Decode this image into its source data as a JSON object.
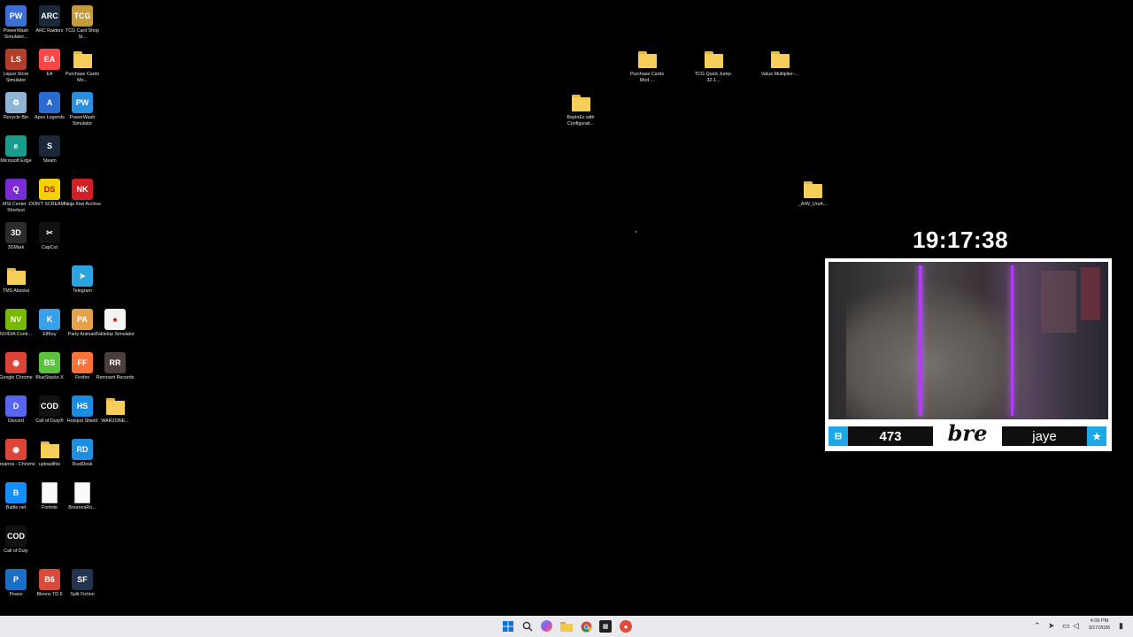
{
  "desktop": {
    "left_icons": [
      {
        "label": "PowerWash Simulator...",
        "icon": "powerwash-simulator-icon",
        "color": "#3b6fd6",
        "glyph": "PW"
      },
      {
        "label": "ARC Raiders",
        "icon": "arc-raiders-icon",
        "color": "#1b2a3a",
        "glyph": "ARC"
      },
      {
        "label": "TCG Card Shop Si...",
        "icon": "tcg-card-shop-icon",
        "color": "#c49a3a",
        "glyph": "TCG"
      },
      {
        "label": "Liquor Store Simulator",
        "icon": "liquor-store-simulator-icon",
        "color": "#b33d2a",
        "glyph": "LS"
      },
      {
        "label": "EA",
        "icon": "ea-app-icon",
        "color": "#ff4747",
        "glyph": "EA"
      },
      {
        "label": "Purchase Cards Mo...",
        "icon": "folder-icon",
        "color": "",
        "glyph": ""
      },
      {
        "label": "Recycle Bin",
        "icon": "recycle-bin-icon",
        "color": "#8fb4d8",
        "glyph": "♻"
      },
      {
        "label": "Apex Legends",
        "icon": "apex-legends-icon",
        "color": "#2a6bd0",
        "glyph": "A"
      },
      {
        "label": "PowerWash Simulator",
        "icon": "powerwash-simulator-icon",
        "color": "#2b8fe0",
        "glyph": "PW"
      },
      {
        "label": "Microsoft Edge",
        "icon": "microsoft-edge-icon",
        "color": "#1a9b8c",
        "glyph": "e"
      },
      {
        "label": "Steam",
        "icon": "steam-icon",
        "color": "#1b2838",
        "glyph": "S"
      },
      {
        "label": "MSI Center - Shortcut",
        "icon": "msi-center-icon",
        "color": "#7a2bd6",
        "glyph": "Q"
      },
      {
        "label": "DON'T SCREAM ...",
        "icon": "dont-scream-icon",
        "color": "#f2d200",
        "glyph": "DS"
      },
      {
        "label": "Ninja Kiwi Archive",
        "icon": "ninja-kiwi-archive-icon",
        "color": "#d21f26",
        "glyph": "NK"
      },
      {
        "label": "3DMark",
        "icon": "3dmark-icon",
        "color": "#2c2c2c",
        "glyph": "3D"
      },
      {
        "label": "CapCut",
        "icon": "capcut-icon",
        "color": "#111111",
        "glyph": "✂"
      },
      {
        "label": "TMS Absolut",
        "icon": "folder-icon",
        "color": "",
        "glyph": ""
      },
      {
        "label": "Telegram",
        "icon": "telegram-icon",
        "color": "#2aa3df",
        "glyph": "➤"
      },
      {
        "label": "NVIDIA Contr...",
        "icon": "nvidia-control-panel-icon",
        "color": "#76b900",
        "glyph": "NV"
      },
      {
        "label": "ElfKey",
        "icon": "elfkey-icon",
        "color": "#3aa0e8",
        "glyph": "K"
      },
      {
        "label": "Party Animals",
        "icon": "party-animals-icon",
        "color": "#e3a24a",
        "glyph": "PA"
      },
      {
        "label": "Tabletop Simulator",
        "icon": "tabletop-simulator-icon",
        "color": "#f4f4f4",
        "glyph": "♠"
      },
      {
        "label": "Google Chrome",
        "icon": "google-chrome-icon",
        "color": "#db4437",
        "glyph": "◉"
      },
      {
        "label": "BlueStacks X",
        "icon": "bluestacks-x-icon",
        "color": "#5ac23c",
        "glyph": "BS"
      },
      {
        "label": "Firefox",
        "icon": "firefox-icon",
        "color": "#ff7139",
        "glyph": "FF"
      },
      {
        "label": "Remnant Records",
        "icon": "remnant-records-icon",
        "color": "#4a3f3c",
        "glyph": "RR"
      },
      {
        "label": "Discord",
        "icon": "discord-icon",
        "color": "#5865f2",
        "glyph": "D"
      },
      {
        "label": "Call of Duty®",
        "icon": "call-of-duty-icon",
        "color": "#111111",
        "glyph": "COD"
      },
      {
        "label": "Hotspot Shield",
        "icon": "hotspot-shield-icon",
        "color": "#1b8de0",
        "glyph": "HS"
      },
      {
        "label": "WARZONE...",
        "icon": "folder-icon",
        "color": "",
        "glyph": ""
      },
      {
        "label": "Breanna - Chrome",
        "icon": "google-chrome-icon",
        "color": "#db4437",
        "glyph": "◉"
      },
      {
        "label": "uploadthis",
        "icon": "folder-icon",
        "color": "",
        "glyph": ""
      },
      {
        "label": "RustDesk",
        "icon": "rustdesk-icon",
        "color": "#1d8fe1",
        "glyph": "RD"
      },
      {
        "label": "Battle.net",
        "icon": "battle-net-icon",
        "color": "#148eff",
        "glyph": "B"
      },
      {
        "label": "Fortnite",
        "icon": "document-icon",
        "color": "",
        "glyph": ""
      },
      {
        "label": "BreannaRo...",
        "icon": "document-icon",
        "color": "",
        "glyph": ""
      },
      {
        "label": "Call of Duty",
        "icon": "call-of-duty-icon",
        "color": "#111111",
        "glyph": "COD"
      },
      {
        "label": "Peace",
        "icon": "peace-app-icon",
        "color": "#1a6fc4",
        "glyph": "P"
      },
      {
        "label": "Bloons TD 6",
        "icon": "bloons-td6-icon",
        "color": "#d94a3a",
        "glyph": "B6"
      },
      {
        "label": "Split Fiction",
        "icon": "split-fiction-icon",
        "color": "#23344f",
        "glyph": "SF"
      }
    ],
    "right_icons": [
      {
        "label": "Purchase Cards Mod ...",
        "icon": "zip-folder-icon"
      },
      {
        "label": "TCG Quick Jump-32-1...",
        "icon": "folder-icon"
      },
      {
        "label": "Value Multiplier-...",
        "icon": "folder-icon"
      },
      {
        "label": "BepInEx with Configurati...",
        "icon": "folder-icon"
      },
      {
        "label": "_AIW_UrsA...",
        "icon": "folder-icon"
      }
    ]
  },
  "overlay": {
    "clock": "19:17:38",
    "viewer_count": "473",
    "username": "jaye",
    "logo_text": "bre",
    "accent": "#1ea7e6"
  },
  "taskbar": {
    "time": "4:09 PM",
    "date": "3/17/2026"
  }
}
